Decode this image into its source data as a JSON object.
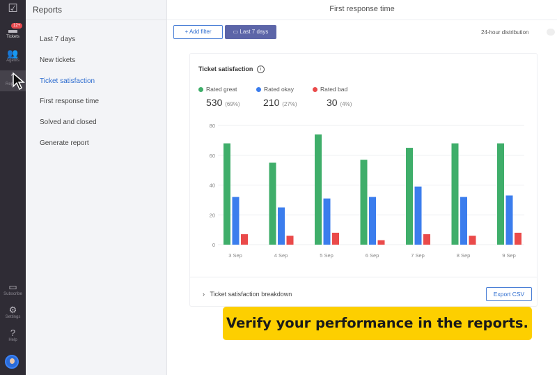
{
  "rail": {
    "items": [
      {
        "label": "Tickets",
        "badge": "12+",
        "icon": "ticket-icon"
      },
      {
        "label": "Agents",
        "icon": "agents-icon"
      },
      {
        "label": "Reports",
        "icon": "reports-icon"
      },
      {
        "label": "Subscribe",
        "icon": "card-icon"
      },
      {
        "label": "Settings",
        "icon": "gear-icon"
      },
      {
        "label": "Help",
        "icon": "help-icon"
      }
    ]
  },
  "sidebar": {
    "title": "Reports",
    "items": [
      "Last 7 days",
      "New tickets",
      "Ticket satisfaction",
      "First response time",
      "Solved and closed",
      "Generate report"
    ],
    "selected": "Ticket satisfaction"
  },
  "header": {
    "title": "First response time"
  },
  "toolbar": {
    "add_filter": "+ Add filter",
    "date_range": "Last 7 days",
    "distribution_label": "24-hour distribution",
    "distribution_on": false
  },
  "card": {
    "title": "Ticket satisfaction",
    "summary": [
      {
        "label": "Rated great",
        "value": "530",
        "pct": "(69%)",
        "color": "#3fae6a"
      },
      {
        "label": "Rated okay",
        "value": "210",
        "pct": "(27%)",
        "color": "#3b7ded"
      },
      {
        "label": "Rated bad",
        "value": "30",
        "pct": "(4%)",
        "color": "#ea4a4a"
      }
    ],
    "breakdown": "Ticket satisfaction breakdown",
    "export": "Export CSV"
  },
  "chart_data": {
    "type": "bar",
    "categories": [
      "3 Sep",
      "4 Sep",
      "5 Sep",
      "6 Sep",
      "7 Sep",
      "8 Sep",
      "9 Sep"
    ],
    "series": [
      {
        "name": "Rated great",
        "color": "#3fae6a",
        "values": [
          68,
          55,
          74,
          57,
          65,
          68,
          68
        ]
      },
      {
        "name": "Rated okay",
        "color": "#3b7ded",
        "values": [
          32,
          25,
          31,
          32,
          39,
          32,
          33
        ]
      },
      {
        "name": "Rated bad",
        "color": "#ea4a4a",
        "values": [
          7,
          6,
          8,
          3,
          7,
          6,
          8
        ]
      }
    ],
    "ylim": [
      0,
      80
    ],
    "yticks": [
      0,
      20,
      40,
      60,
      80
    ],
    "grid": true
  },
  "banner": "Verify your performance in the reports."
}
